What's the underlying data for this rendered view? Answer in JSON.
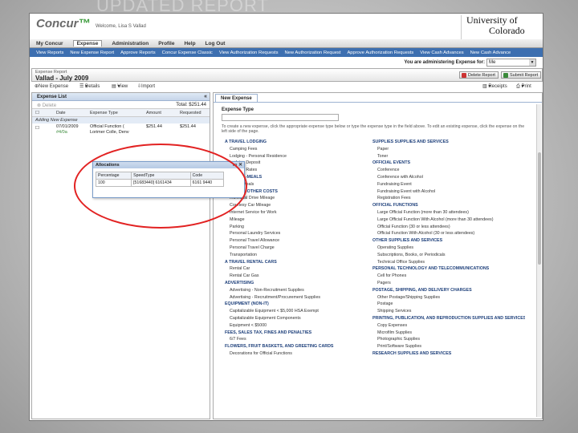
{
  "ghost_title": "UPDATED REPORT",
  "header": {
    "logo_main": "Concur",
    "welcome": "Welcome, Lisa S Vallad",
    "university_line1": "University of",
    "university_line2": "Colorado"
  },
  "nav": {
    "tabs": [
      "My Concur",
      "Expense",
      "Administration",
      "Profile",
      "Help",
      "Log Out"
    ],
    "active": "Expense"
  },
  "subnav": [
    "View Reports",
    "New Expense Report",
    "Approve Reports",
    "Concur Expense Classic",
    "View Authorization Requests",
    "New Authorization Request",
    "Approve Authorization Requests",
    "View Cash Advances",
    "New Cash Advance"
  ],
  "admin": {
    "label": "You are administering Expense for:",
    "value": "Me"
  },
  "report": {
    "label": "Expense Report",
    "name": "Vallad - July 2009",
    "delete_button": "Delete Report",
    "submit_button": "Submit Report"
  },
  "toolbar": {
    "new_expense": "New Expense",
    "details": "Details",
    "view": "View",
    "import": "Import",
    "receipts": "Receipts",
    "print": "Print"
  },
  "left_panel": {
    "title": "Expense List",
    "delete_label": "Delete",
    "total": "Total: $251.44",
    "columns": [
      "Date",
      "Expense Type",
      "Amount",
      "Requested"
    ],
    "adding": "Adding New Expense",
    "expense": {
      "date": "07/01/2009",
      "type_line1": "Official Function (",
      "type_line2": "Lorimer Colle, Denv",
      "amount": "$251.44",
      "requested": "$251.44",
      "extra": "#4/0a"
    }
  },
  "allocations": {
    "title": "Allocations",
    "headers": [
      "Percentage",
      "SpeedType",
      "Code"
    ],
    "rows": [
      [
        "100",
        "[51683440] 6161434",
        "6161 9440"
      ]
    ]
  },
  "right_panel": {
    "tab": "New Expense",
    "expense_type_label": "Expense Type",
    "instructions": "To create a new expense, click the appropriate expense type below or type the expense type in the field above. To edit an existing expense, click the expense on the left side of the page.",
    "left_column": [
      {
        "t": "A TRAVEL LODGING",
        "c": true
      },
      {
        "t": "Camping Fees"
      },
      {
        "t": "Lodging - Personal Residence"
      },
      {
        "t": "Lodging Deposit"
      },
      {
        "t": "Lodging Rates"
      },
      {
        "t": "A TRAVEL-MEALS",
        "c": true
      },
      {
        "t": "Group Meals"
      },
      {
        "t": "A TRAVEL-OTHER COSTS",
        "c": true
      },
      {
        "t": "Individual Drive Mileage"
      },
      {
        "t": "Courtesy Car Mileage"
      },
      {
        "t": "Internet Service for Work"
      },
      {
        "t": "Mileage"
      },
      {
        "t": "Parking"
      },
      {
        "t": "Personal Laundry Services"
      },
      {
        "t": "Personal Travel Allowance"
      },
      {
        "t": "Personal Travel Charge"
      },
      {
        "t": "Transportation"
      },
      {
        "t": "A TRAVEL RENTAL CARS",
        "c": true
      },
      {
        "t": "Rental Car"
      },
      {
        "t": "Rental Car Gas"
      },
      {
        "t": "ADVERTISING",
        "c": true
      },
      {
        "t": "Advertising - Non-Recruitment Supplies"
      },
      {
        "t": "Advertising - Recruitment/Procurement Supplies"
      },
      {
        "t": "EQUIPMENT (NON-IT)",
        "c": true
      },
      {
        "t": "Capitalizable Equipment < $5,000 HSA Exempt"
      },
      {
        "t": "Capitalizable Equipment Components"
      },
      {
        "t": "Equipment < $5000"
      },
      {
        "t": "FEES, SALES TAX, FINES AND PENALTIES",
        "c": true
      },
      {
        "t": "6/7 Fees"
      },
      {
        "t": "FLOWERS, FRUIT BASKETS, AND GREETING CARDS",
        "c": true
      },
      {
        "t": "Decorations for Official Functions"
      }
    ],
    "right_column": [
      {
        "t": "SUPPLIES SUPPLIES AND SERVICES",
        "c": true
      },
      {
        "t": "Paper"
      },
      {
        "t": "Toner"
      },
      {
        "t": "OFFICIAL EVENTS",
        "c": true
      },
      {
        "t": "Conference"
      },
      {
        "t": "Conference with Alcohol"
      },
      {
        "t": "Fundraising Event"
      },
      {
        "t": "Fundraising Event with Alcohol"
      },
      {
        "t": "Registration Fees"
      },
      {
        "t": "OFFICIAL FUNCTIONS",
        "c": true
      },
      {
        "t": "Large Official Function (more than 30 attendees)"
      },
      {
        "t": "Large Official Function With Alcohol (more than 30 attendees)"
      },
      {
        "t": "Official Function (30 or less attendees)"
      },
      {
        "t": "Official Function With Alcohol (30 or less attendees)"
      },
      {
        "t": "OTHER SUPPLIES AND SERVICES",
        "c": true
      },
      {
        "t": "Operating Supplies"
      },
      {
        "t": "Subscriptions, Books, or Periodicals"
      },
      {
        "t": "Technical Office Supplies"
      },
      {
        "t": "PERSONAL TECHNOLOGY AND TELECOMMUNICATIONS",
        "c": true
      },
      {
        "t": "Cell for Phones"
      },
      {
        "t": "Pagers"
      },
      {
        "t": "POSTAGE, SHIPPING, AND DELIVERY CHARGES",
        "c": true
      },
      {
        "t": "Other Postage/Shipping Supplies"
      },
      {
        "t": "Postage"
      },
      {
        "t": "Shipping Services"
      },
      {
        "t": "PRINTING, PUBLICATION, AND REPRODUCTION SUPPLIES AND SERVICES",
        "c": true
      },
      {
        "t": "Copy Expenses"
      },
      {
        "t": "Microfilm Supplies"
      },
      {
        "t": "Photographic Supplies"
      },
      {
        "t": "Print/Software Supplies"
      },
      {
        "t": "RESEARCH SUPPLIES AND SERVICES",
        "c": true
      }
    ]
  },
  "colors": {
    "nav_blue": "#3d6fb0",
    "category_blue": "#1d3f7a",
    "highlight_red": "#e22222"
  }
}
